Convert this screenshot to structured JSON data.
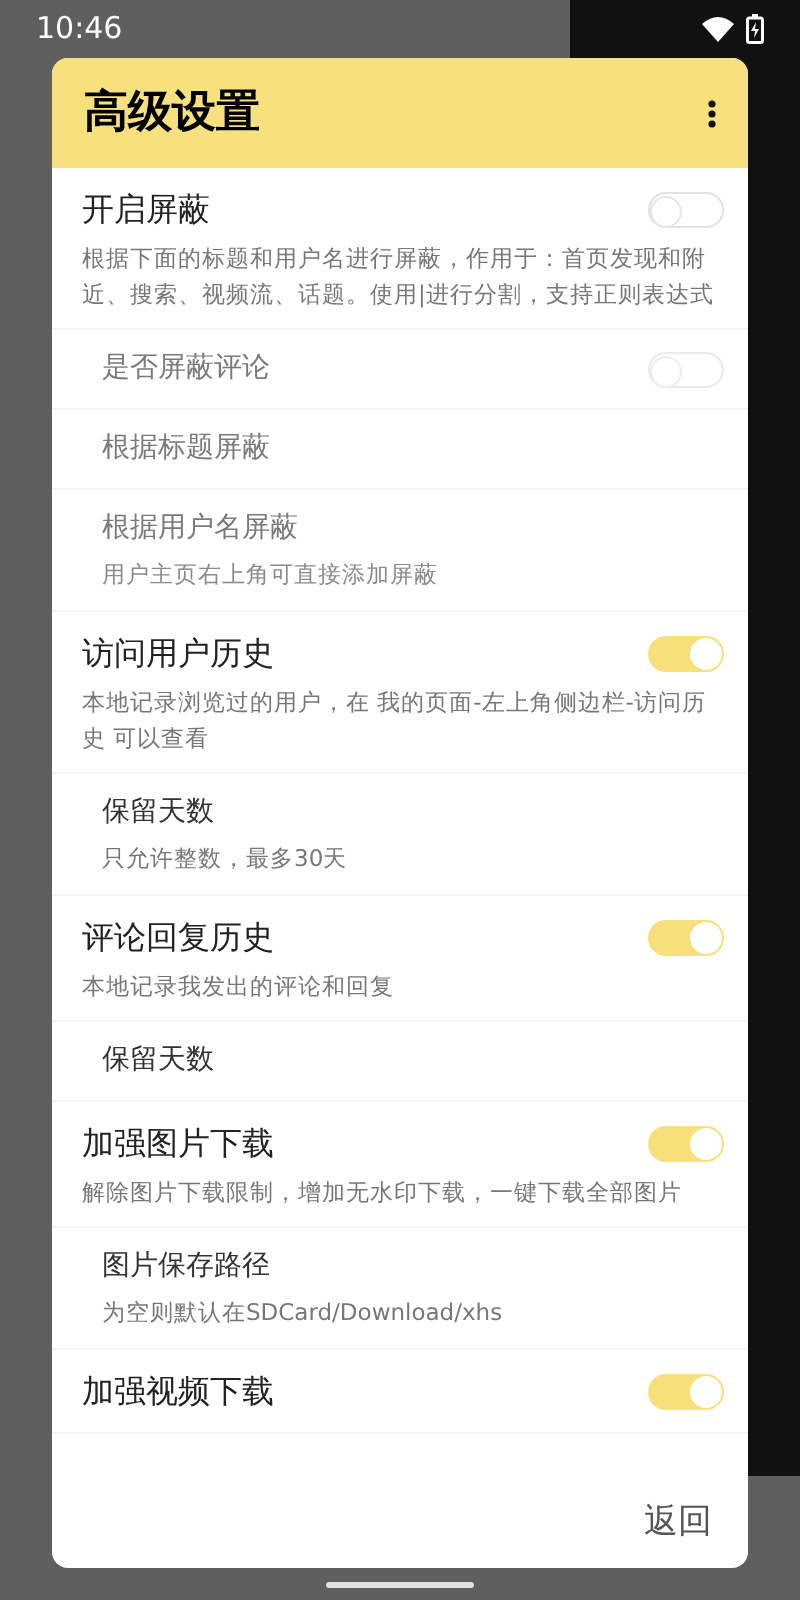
{
  "status_bar": {
    "time": "10:46"
  },
  "dialog": {
    "title": "高级设置",
    "items": [
      {
        "kind": "main",
        "title": "开启屏蔽",
        "description": "根据下面的标题和用户名进行屏蔽，作用于：首页发现和附近、搜索、视频流、话题。使用|进行分割，支持正则表达式",
        "on": false,
        "disabled": false
      },
      {
        "kind": "sub",
        "title": "是否屏蔽评论",
        "on": false,
        "disabled": true
      },
      {
        "kind": "sub",
        "title": "根据标题屏蔽",
        "disabled": true
      },
      {
        "kind": "sub",
        "title": "根据用户名屏蔽",
        "description": "用户主页右上角可直接添加屏蔽",
        "disabled": true
      },
      {
        "kind": "main",
        "title": "访问用户历史",
        "description": "本地记录浏览过的用户，在 我的页面-左上角侧边栏-访问历史 可以查看",
        "on": true,
        "disabled": false
      },
      {
        "kind": "sub",
        "title": "保留天数",
        "description": "只允许整数，最多30天",
        "disabled": false
      },
      {
        "kind": "main",
        "title": "评论回复历史",
        "description": "本地记录我发出的评论和回复",
        "on": true,
        "disabled": false
      },
      {
        "kind": "sub",
        "title": "保留天数",
        "disabled": false
      },
      {
        "kind": "main",
        "title": "加强图片下载",
        "description": "解除图片下载限制，增加无水印下载，一键下载全部图片",
        "on": true,
        "disabled": false
      },
      {
        "kind": "sub",
        "title": "图片保存路径",
        "description": "为空则默认在SDCard/Download/xhs",
        "disabled": false
      },
      {
        "kind": "main",
        "title": "加强视频下载",
        "on": true,
        "disabled": false
      }
    ],
    "button": "返回"
  }
}
